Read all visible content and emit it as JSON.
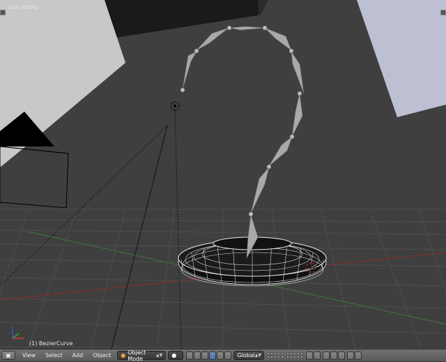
{
  "viewport": {
    "view_label": "User Ortho",
    "object_label": "(1) BezierCurve"
  },
  "header": {
    "editor_type_icon": "3d-view-icon",
    "menus": [
      "View",
      "Select",
      "Add",
      "Object"
    ],
    "mode": "Object Mode",
    "orientation": "Global"
  },
  "colors": {
    "viewport_bg": "#3f3f3f",
    "x_axis": "#8a2a2a",
    "y_axis": "#3a7a3a",
    "header_bg": "#6a6a6a"
  }
}
